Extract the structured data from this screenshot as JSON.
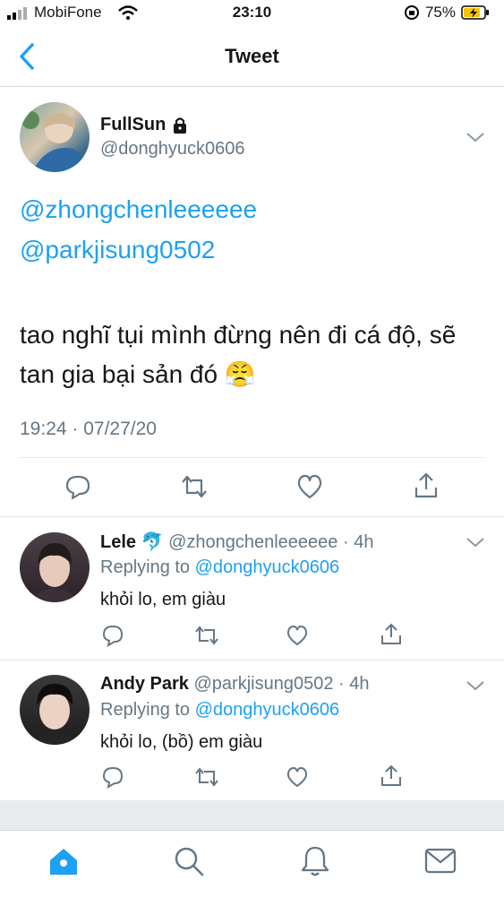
{
  "status_bar": {
    "carrier": "MobiFone",
    "time": "23:10",
    "battery": "75%"
  },
  "nav": {
    "title": "Tweet"
  },
  "main_tweet": {
    "display_name": "FullSun",
    "handle": "@donghyuck0606",
    "mention_1": "@zhongchenleeeeee",
    "mention_2": "@parkjisung0502",
    "body": "tao nghĩ tụi mình đừng nên đi cá độ, sẽ tan gia bại sản đó 😤",
    "timestamp": "19:24 · 07/27/20"
  },
  "replies": [
    {
      "display_name": "Lele",
      "name_emoji": "🐬",
      "handle": "@zhongchenleeeeee",
      "age": "· 4h",
      "replying_prefix": "Replying to",
      "replying_to": "@donghyuck0606",
      "text": "khỏi lo, em giàu"
    },
    {
      "display_name": "Andy Park",
      "name_emoji": "",
      "handle": "@parkjisung0502",
      "age": "· 4h",
      "replying_prefix": "Replying to",
      "replying_to": "@donghyuck0606",
      "text": "khỏi lo, (bồ) em giàu"
    }
  ],
  "colors": {
    "accent": "#1da1f2",
    "text": "#14171a",
    "secondary": "#657786",
    "icon": "#657786"
  }
}
